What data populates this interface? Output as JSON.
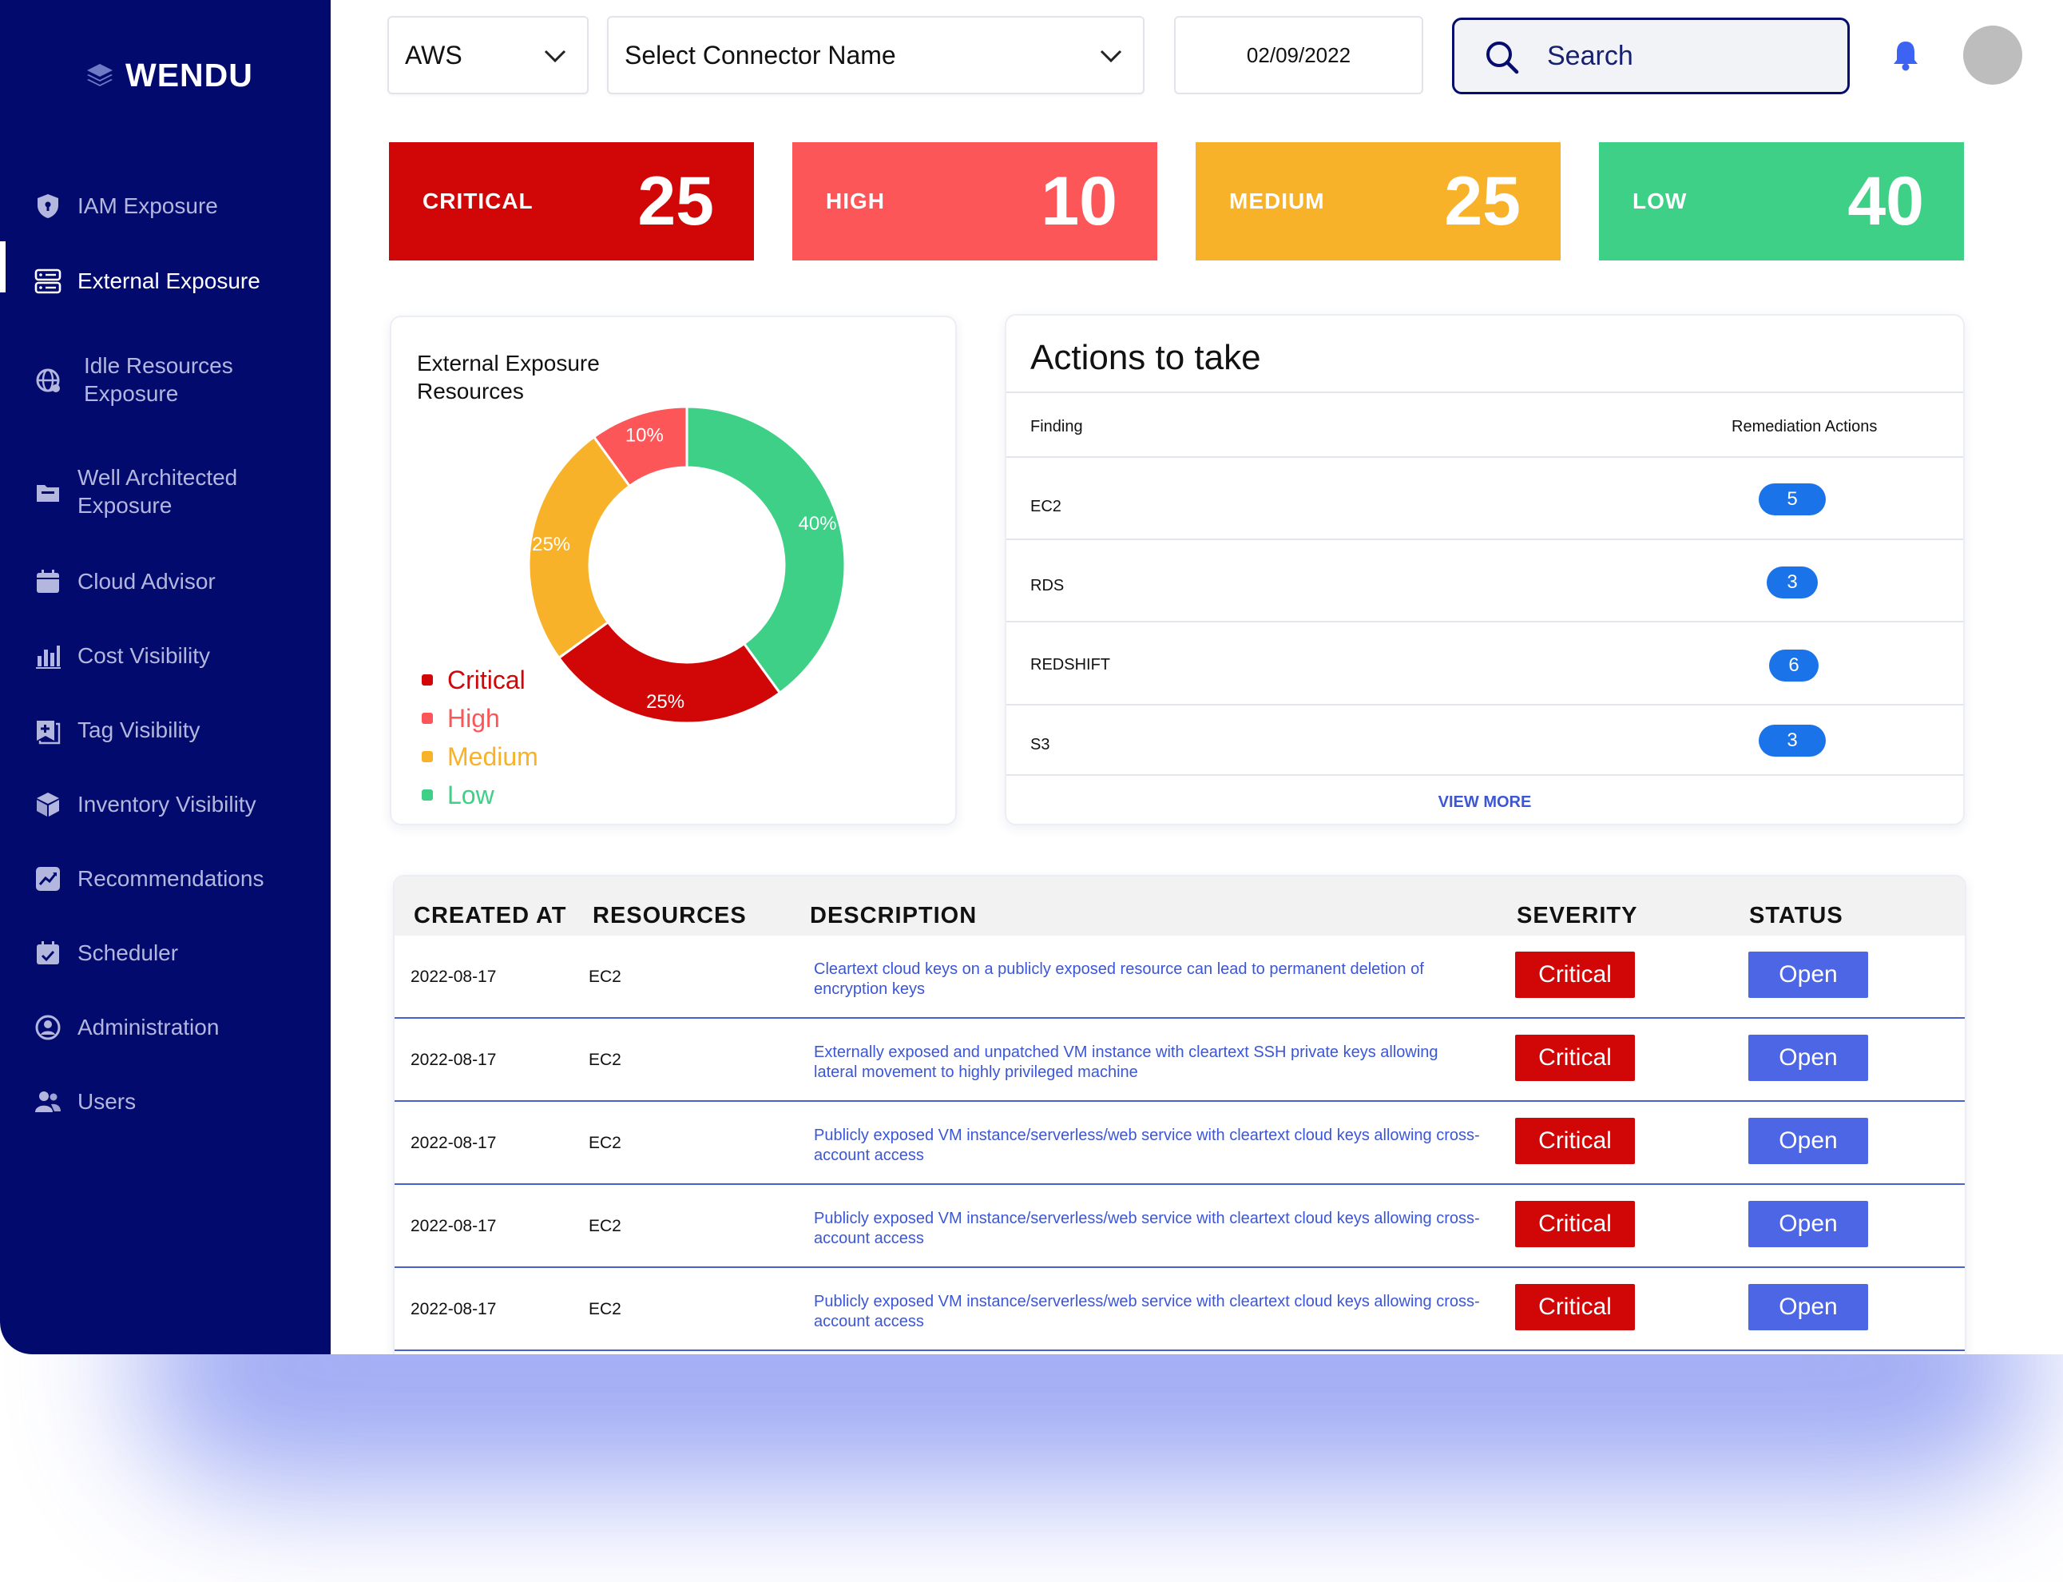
{
  "brand": {
    "name": "WENDU"
  },
  "sidebar": {
    "items": [
      {
        "label": "IAM Exposure",
        "icon": "shield-icon"
      },
      {
        "label": "External Exposure",
        "icon": "server-icon",
        "active": true
      },
      {
        "label": "Idle Resources Exposure",
        "icon": "globe-icon"
      },
      {
        "label": "Well Architected Exposure",
        "icon": "folder-icon"
      },
      {
        "label": "Cloud Advisor",
        "icon": "calendar-icon"
      },
      {
        "label": "Cost Visibility",
        "icon": "bar-chart-icon"
      },
      {
        "label": "Tag Visibility",
        "icon": "tag-icon"
      },
      {
        "label": "Inventory Visibility",
        "icon": "cube-icon"
      },
      {
        "label": "Recommendations",
        "icon": "trend-icon"
      },
      {
        "label": "Scheduler",
        "icon": "scheduler-icon"
      },
      {
        "label": "Administration",
        "icon": "user-circle-icon"
      },
      {
        "label": "Users",
        "icon": "users-icon"
      }
    ]
  },
  "header": {
    "provider": "AWS",
    "connector_placeholder": "Select Connector Name",
    "date": "02/09/2022",
    "search_placeholder": "Search"
  },
  "kpis": [
    {
      "label": "CRITICAL",
      "value": "25",
      "color": "#d10707"
    },
    {
      "label": "HIGH",
      "value": "10",
      "color": "#fc5658"
    },
    {
      "label": "MEDIUM",
      "value": "25",
      "color": "#f8b22a"
    },
    {
      "label": "LOW",
      "value": "40",
      "color": "#3dd086"
    }
  ],
  "donut": {
    "title": "External Exposure Resources",
    "chart_data": {
      "type": "pie",
      "categories": [
        "Critical",
        "High",
        "Medium",
        "Low"
      ],
      "values": [
        25,
        10,
        25,
        40
      ],
      "labels": [
        "25%",
        "10%",
        "25%",
        "40%"
      ],
      "colors": [
        "#d10707",
        "#fc5658",
        "#f8b22a",
        "#3dd086"
      ]
    },
    "legend": [
      {
        "label": "Critical",
        "color": "#d10707"
      },
      {
        "label": "High",
        "color": "#fc5658"
      },
      {
        "label": "Medium",
        "color": "#f8b22a"
      },
      {
        "label": "Low",
        "color": "#3dd086"
      }
    ]
  },
  "actions": {
    "title": "Actions to take",
    "col_finding": "Finding",
    "col_remediation": "Remediation Actions",
    "rows": [
      {
        "finding": "EC2",
        "count": "5"
      },
      {
        "finding": "RDS",
        "count": "3"
      },
      {
        "finding": "REDSHIFT",
        "count": "6"
      },
      {
        "finding": "S3",
        "count": "3"
      }
    ],
    "view_more": "VIEW MORE"
  },
  "findings": {
    "headers": {
      "created": "CREATED AT",
      "resources": "RESOURCES",
      "description": "DESCRIPTION",
      "severity": "SEVERITY",
      "status": "STATUS"
    },
    "rows": [
      {
        "created": "2022-08-17",
        "resource": "EC2",
        "description": "Cleartext cloud keys on a publicly exposed resource can lead to permanent deletion of encryption keys",
        "severity": "Critical",
        "status": "Open"
      },
      {
        "created": "2022-08-17",
        "resource": "EC2",
        "description": "Externally exposed and unpatched VM instance with cleartext SSH private keys allowing lateral movement to highly privileged machine",
        "severity": "Critical",
        "status": "Open"
      },
      {
        "created": "2022-08-17",
        "resource": "EC2",
        "description": "Publicly exposed VM instance/serverless/web service with cleartext cloud keys allowing cross-account access",
        "severity": "Critical",
        "status": "Open"
      },
      {
        "created": "2022-08-17",
        "resource": "EC2",
        "description": "Publicly exposed VM instance/serverless/web service with cleartext cloud keys allowing cross-account access",
        "severity": "Critical",
        "status": "Open"
      },
      {
        "created": "2022-08-17",
        "resource": "EC2",
        "description": "Publicly exposed VM instance/serverless/web service with cleartext cloud keys allowing cross-account access",
        "severity": "Critical",
        "status": "Open"
      }
    ]
  }
}
